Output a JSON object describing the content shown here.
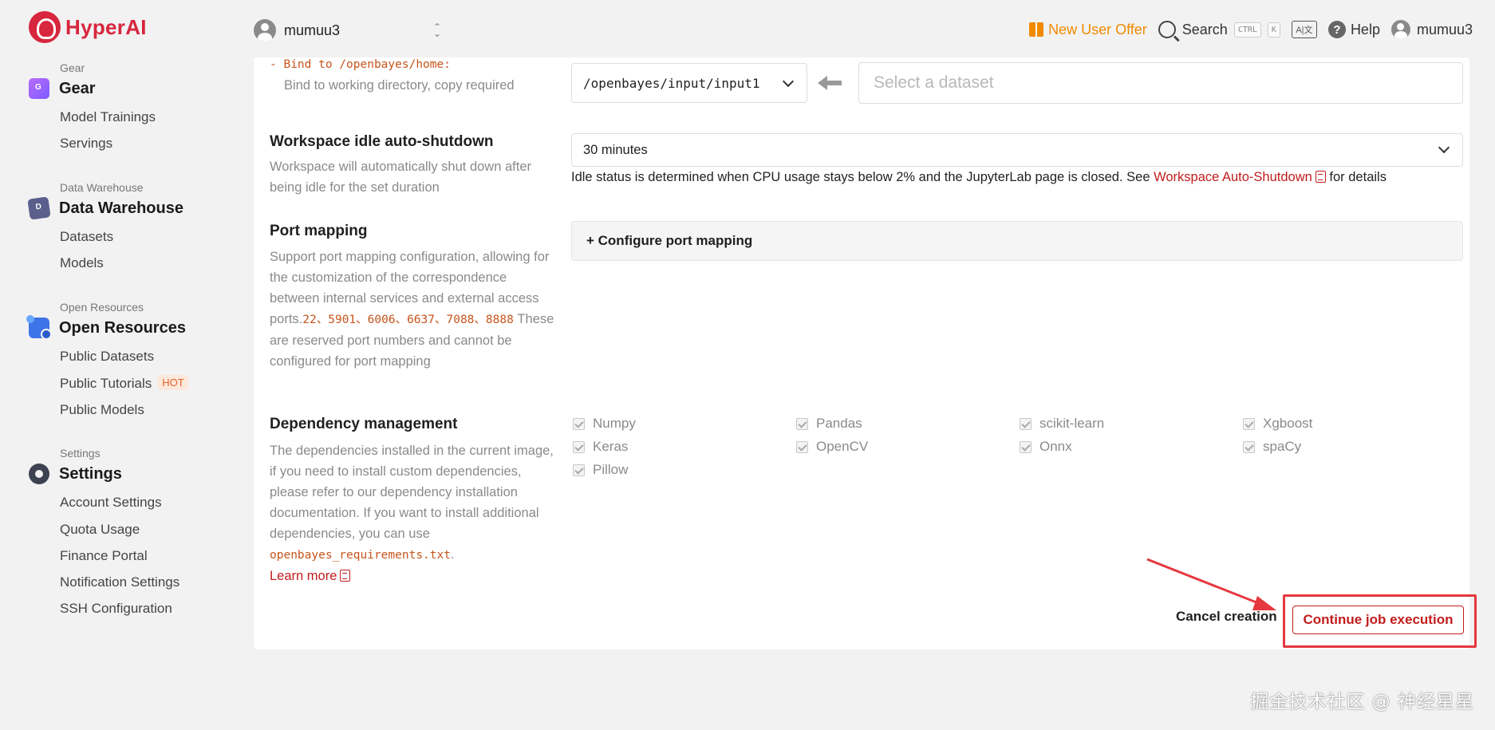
{
  "brand": {
    "name": "HyperAI"
  },
  "org_switcher": {
    "name": "mumuu3"
  },
  "topbar": {
    "offer": "New User Offer",
    "search": "Search",
    "shortcut_ctrl": "CTRL",
    "shortcut_k": "K",
    "lang_icon_text": "A|文",
    "help": "Help",
    "user": "mumuu3"
  },
  "sidebar": {
    "gear": {
      "caption": "Gear",
      "title": "Gear",
      "items": [
        "Model Trainings",
        "Servings"
      ]
    },
    "data_warehouse": {
      "caption": "Data Warehouse",
      "title": "Data Warehouse",
      "items": [
        "Datasets",
        "Models"
      ]
    },
    "open_resources": {
      "caption": "Open Resources",
      "title": "Open Resources",
      "items": [
        "Public Datasets",
        "Public Tutorials",
        "Public Models"
      ],
      "hot_badge": "HOT"
    },
    "settings": {
      "caption": "Settings",
      "title": "Settings",
      "items": [
        "Account Settings",
        "Quota Usage",
        "Finance Portal",
        "Notification Settings",
        "SSH Configuration"
      ]
    }
  },
  "binding": {
    "bind_line": "- Bind to /openbayes/home:",
    "bind_desc": "Bind to working directory, copy required",
    "path_value": "/openbayes/input/input1",
    "dataset_placeholder": "Select a dataset"
  },
  "idle": {
    "title": "Workspace idle auto-shutdown",
    "desc": "Workspace will automatically shut down after being idle for the set duration",
    "value": "30 minutes",
    "note_prefix": "Idle status is determined when CPU usage stays below 2% and the JupyterLab page is closed. See ",
    "note_link": "Workspace Auto-Shutdown",
    "note_suffix": " for details"
  },
  "port": {
    "title": "Port mapping",
    "desc_prefix": "Support port mapping configuration, allowing for the customization of the correspondence between internal services and external access ports.",
    "reserved_ports": "22、5901、6006、6637、7088、8888",
    "desc_suffix": " These are reserved port numbers and cannot be configured for port mapping",
    "configure_btn": "+ Configure port mapping"
  },
  "deps": {
    "title": "Dependency management",
    "desc_prefix": "The dependencies installed in the current image, if you need to install custom dependencies, please refer to our dependency installation documentation. If you want to install additional dependencies, you can use ",
    "req_file": "openbayes_requirements.txt",
    "desc_suffix": ".",
    "learn_more": "Learn more",
    "packages": [
      "Numpy",
      "Pandas",
      "scikit-learn",
      "Xgboost",
      "Keras",
      "OpenCV",
      "Onnx",
      "spaCy",
      "Pillow"
    ]
  },
  "actions": {
    "cancel": "Cancel creation",
    "continue": "Continue job execution"
  },
  "watermark": "掘金技术社区 @ 神经星星",
  "colors": {
    "accent": "#c21d1d",
    "offer": "#f08a00",
    "annotation": "#e5383f"
  }
}
